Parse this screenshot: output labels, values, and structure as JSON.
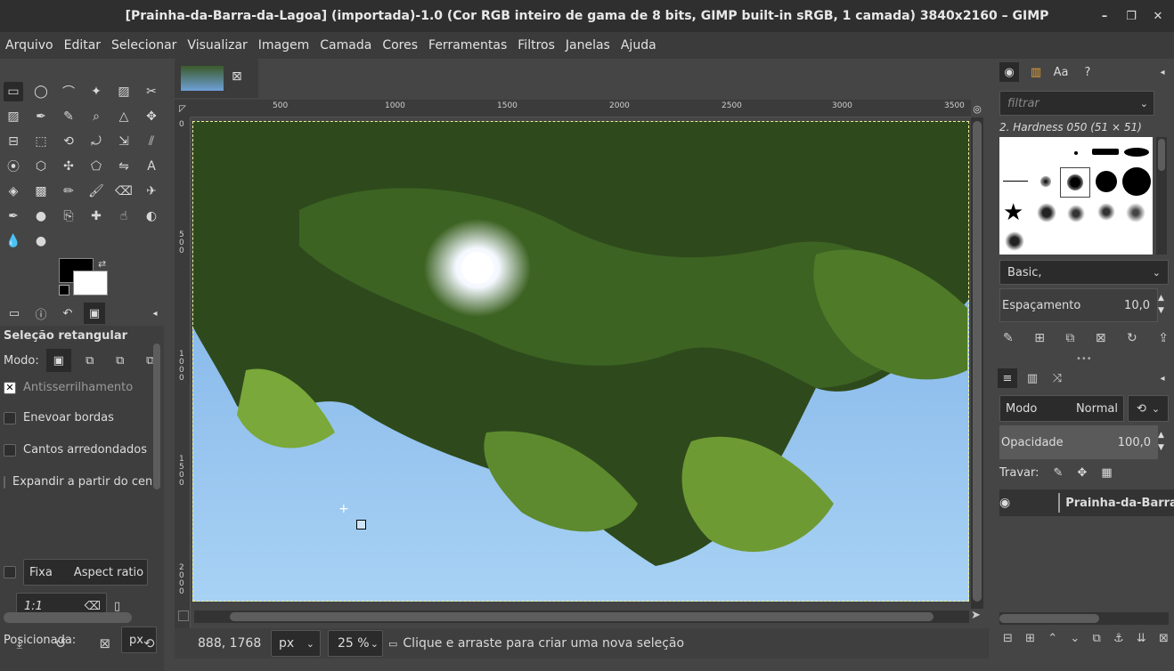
{
  "window": {
    "title": "[Prainha-da-Barra-da-Lagoa] (importada)-1.0 (Cor RGB inteiro de gama de 8 bits, GIMP built-in sRGB, 1 camada) 3840x2160 – GIMP",
    "controls": [
      "–",
      "❐",
      "✕"
    ]
  },
  "menu": [
    "Arquivo",
    "Editar",
    "Selecionar",
    "Visualizar",
    "Imagem",
    "Camada",
    "Cores",
    "Ferramentas",
    "Filtros",
    "Janelas",
    "Ajuda"
  ],
  "toolbox": {
    "icons": [
      "rect-select-icon",
      "ellipse-select-icon",
      "free-select-icon",
      "fuzzy-select-icon",
      "color-select-icon",
      "scissors-icon",
      "foreground-select-icon",
      "paths-icon",
      "color-picker-icon",
      "zoom-icon",
      "measure-icon",
      "move-icon",
      "align-icon",
      "crop-icon",
      "unified-transform-icon",
      "rotate-icon",
      "scale-icon",
      "shear-icon",
      "warp-icon",
      "cage-icon",
      "handle-transform-icon",
      "perspective-icon",
      "flip-icon",
      "text-icon",
      "bucket-fill-icon",
      "gradient-icon",
      "pencil-icon",
      "paintbrush-icon",
      "eraser-icon",
      "airbrush-icon",
      "ink-icon",
      "mypaint-icon",
      "clone-icon",
      "heal-icon",
      "smudge-icon",
      "dodge-icon",
      "blur-icon",
      "tool-misc-icon"
    ]
  },
  "tool_options": {
    "title": "Seleção retangular",
    "mode_label": "Modo:",
    "antialias": "Antisserrilhamento",
    "feather": "Enevoar bordas",
    "rounded": "Cantos arredondados",
    "expand": "Expandir a partir do centro",
    "fixed_label": "Fixa",
    "aspect_label": "Aspect ratio",
    "ratio_value": "1:1",
    "position_label": "Posicionada:",
    "unit": "px"
  },
  "canvas": {
    "ruler_top": [
      "500",
      "1000",
      "1500",
      "2000",
      "2500",
      "3000",
      "3500"
    ],
    "ruler_left": [
      "0",
      "5\n0\n0",
      "1\n0\n0\n0",
      "1\n5\n0\n0",
      "2\n0\n0\n0"
    ]
  },
  "status": {
    "coords": "888, 1768",
    "unit": "px",
    "zoom": "25 %",
    "message": "Clique e arraste para criar uma nova seleção"
  },
  "brushes": {
    "filter_placeholder": "filtrar",
    "selected_name": "2. Hardness 050 (51 × 51)",
    "preset": "Basic,",
    "spacing_label": "Espaçamento",
    "spacing_value": "10,0"
  },
  "layers": {
    "mode_label": "Modo",
    "mode_value": "Normal",
    "opacity_label": "Opacidade",
    "opacity_value": "100,0",
    "lock_label": "Travar:",
    "layer_name": "Prainha-da-Barra-da-Lagoa"
  }
}
